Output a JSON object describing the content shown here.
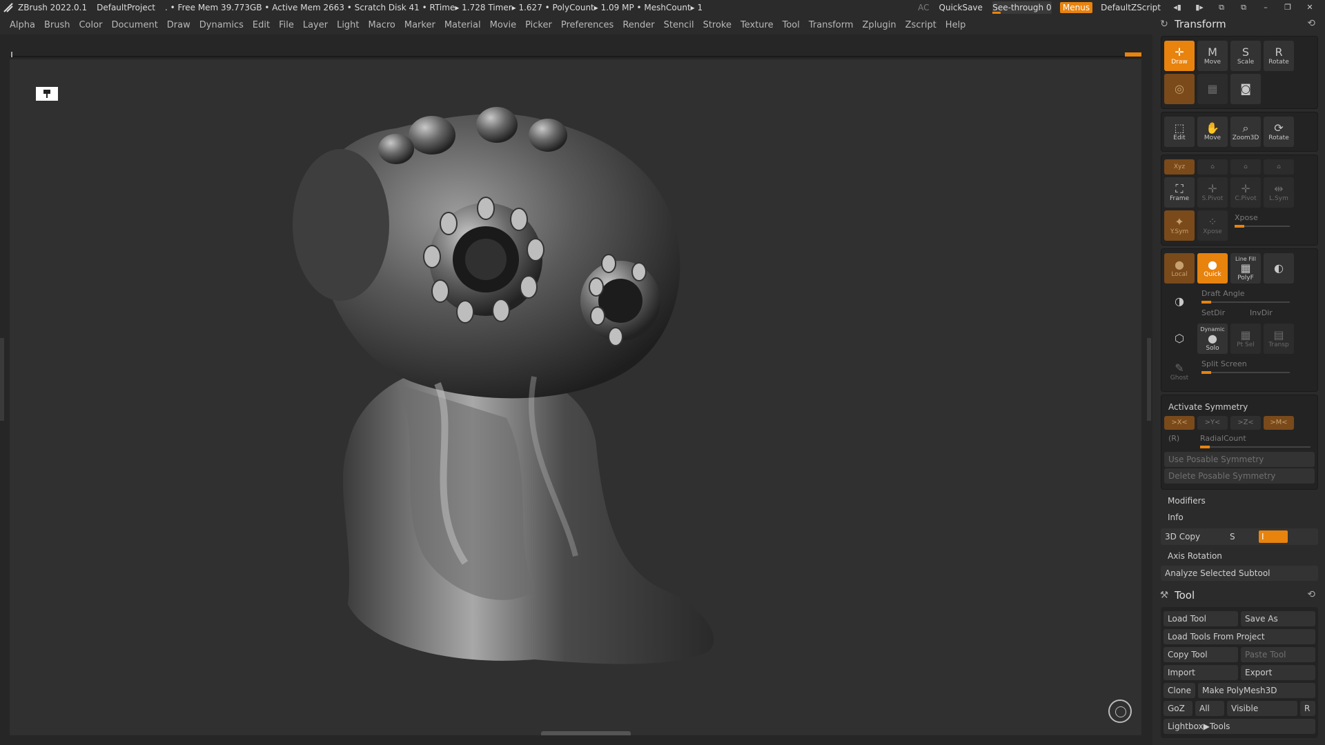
{
  "titlebar": {
    "app": "ZBrush 2022.0.1",
    "project": "DefaultProject",
    "stats": ". • Free Mem 39.773GB • Active Mem 2663 • Scratch Disk 41 •  RTime▸ 1.728 Timer▸ 1.627 • PolyCount▸ 1.09 MP  • MeshCount▸ 1",
    "ac": "AC",
    "quicksave": "QuickSave",
    "seethrough_label": "See-through",
    "seethrough_value": "0",
    "menus": "Menus",
    "script": "DefaultZScript"
  },
  "menubar": [
    "Alpha",
    "Brush",
    "Color",
    "Document",
    "Draw",
    "Dynamics",
    "Edit",
    "File",
    "Layer",
    "Light",
    "Macro",
    "Marker",
    "Material",
    "Movie",
    "Picker",
    "Preferences",
    "Render",
    "Stencil",
    "Stroke",
    "Texture",
    "Tool",
    "Transform",
    "Zplugin",
    "Zscript",
    "Help"
  ],
  "transform": {
    "title": "Transform",
    "row1": [
      "Draw",
      "Move",
      "Scale",
      "Rotate"
    ],
    "edit_row": [
      "Edit",
      "Move",
      "Zoom3D",
      "Rotate"
    ],
    "frame_row": [
      "Frame",
      "S.Pivot",
      "C.Pivot",
      "L.Sym"
    ],
    "xyz": "Xyz",
    "sym_row": [
      "Y.Sym",
      "Xpose"
    ],
    "xpose_label": "Xpose",
    "line_fill": "Line Fill",
    "quick_row": [
      "Local",
      "Quick",
      "PolyF"
    ],
    "draft_angle": "Draft Angle",
    "setdir": "SetDir",
    "invdir": "InvDir",
    "dynamic": "Dynamic",
    "solo_row": [
      "Solo",
      "Pt Sel",
      "Transp"
    ],
    "split_screen": "Split Screen",
    "ghost": "Ghost",
    "activate_symmetry": "Activate Symmetry",
    "sym_axes": [
      ">X<",
      ">Y<",
      ">Z<",
      ">M<"
    ],
    "r_label": "(R)",
    "radial_count": "RadialCount",
    "use_posable": "Use Posable Symmetry",
    "delete_posable": "Delete Posable Symmetry",
    "modifiers": "Modifiers",
    "info": "Info",
    "copy3d": "3D Copy",
    "copy_s": "S",
    "copy_i": "I",
    "axis_rotation": "Axis Rotation",
    "analyze": "Analyze Selected Subtool"
  },
  "tool": {
    "title": "Tool",
    "load_tool": "Load Tool",
    "save_as": "Save As",
    "load_from_project": "Load Tools From Project",
    "copy_tool": "Copy Tool",
    "paste_tool": "Paste Tool",
    "import": "Import",
    "export": "Export",
    "clone": "Clone",
    "make_polymesh": "Make PolyMesh3D",
    "goz": "GoZ",
    "all": "All",
    "visible": "Visible",
    "r": "R",
    "lightbox_tools": "Lightbox▶Tools"
  },
  "colors": {
    "accent": "#e8830e",
    "panel": "#2b2b2b",
    "viewport": "#303030"
  }
}
